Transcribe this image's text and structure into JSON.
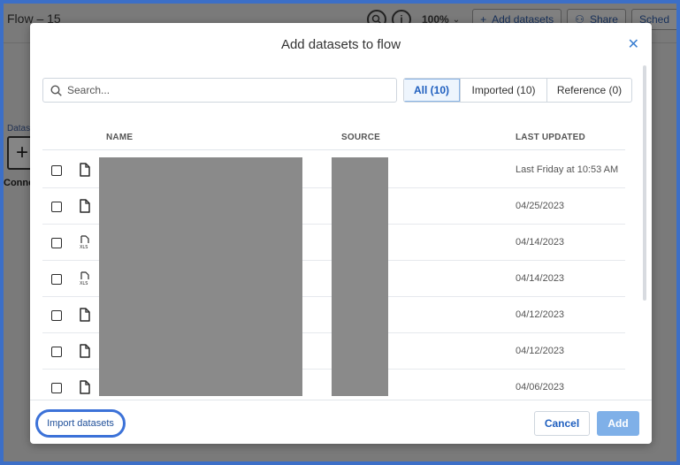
{
  "background": {
    "flow_title": "Flow – 15",
    "zoom": "100%",
    "add_datasets": "Add datasets",
    "share": "Share",
    "schedule": "Sched",
    "side_label": "Datas",
    "connect_label": "Conne"
  },
  "modal": {
    "title": "Add datasets to flow",
    "search_placeholder": "Search...",
    "filters": [
      {
        "label": "All (10)",
        "active": true
      },
      {
        "label": "Imported (10)",
        "active": false
      },
      {
        "label": "Reference (0)",
        "active": false
      }
    ],
    "columns": {
      "name": "NAME",
      "source": "SOURCE",
      "last_updated": "LAST UPDATED"
    },
    "rows": [
      {
        "icon": "file-icon",
        "last_updated": "Last Friday at 10:53 AM"
      },
      {
        "icon": "file-icon",
        "last_updated": "04/25/2023"
      },
      {
        "icon": "xls-file-icon",
        "last_updated": "04/14/2023"
      },
      {
        "icon": "xls-file-icon",
        "last_updated": "04/14/2023"
      },
      {
        "icon": "file-icon",
        "last_updated": "04/12/2023"
      },
      {
        "icon": "file-icon",
        "last_updated": "04/12/2023"
      },
      {
        "icon": "file-icon",
        "last_updated": "04/06/2023"
      }
    ],
    "import_link": "Import datasets",
    "cancel": "Cancel",
    "add": "Add"
  },
  "colors": {
    "accent": "#1f5fbf",
    "highlight_ring": "#3c72d8",
    "add_disabled": "#7fb0e8"
  }
}
